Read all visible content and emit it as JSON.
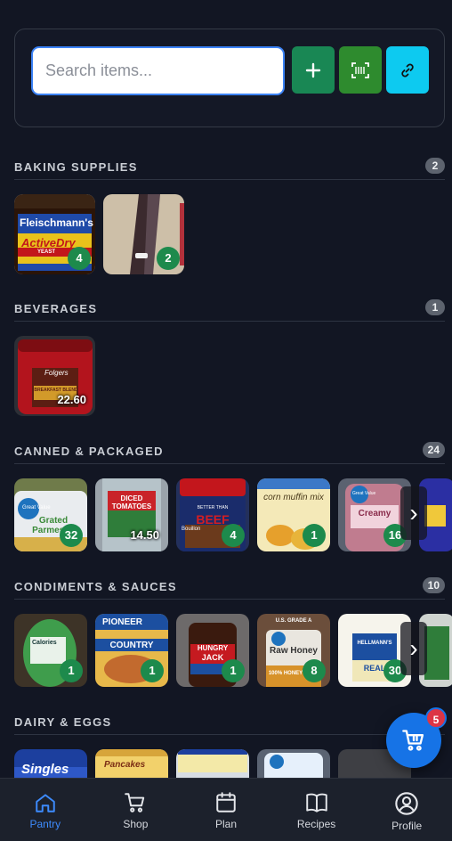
{
  "search": {
    "placeholder": "Search items..."
  },
  "toolbar": {
    "add_icon": "plus-icon",
    "scan_icon": "barcode-scan-icon",
    "link_icon": "link-icon"
  },
  "sections": [
    {
      "title": "BAKING SUPPLIES",
      "count": "2",
      "items": [
        {
          "qty": "4",
          "brand": "Fleischmann's",
          "label": "ActiveDry",
          "sub": "YEAST"
        },
        {
          "qty": "2"
        }
      ]
    },
    {
      "title": "BEVERAGES",
      "count": "1",
      "items": [
        {
          "qty": "22.60",
          "brand": "Folgers",
          "label": "BREAKFAST BLEND"
        }
      ]
    },
    {
      "title": "CANNED & PACKAGED",
      "count": "24",
      "items": [
        {
          "qty": "32",
          "brand": "Great Value",
          "label": "Grated Parmesan"
        },
        {
          "qty": "14.50",
          "label": "DICED TOMATOES"
        },
        {
          "qty": "4",
          "brand": "BETTER THAN",
          "label": "BEEF",
          "sub": "Bouillon"
        },
        {
          "qty": "1",
          "label": "corn muffin mix"
        },
        {
          "qty": "16",
          "brand": "Great Value",
          "label": "Creamy"
        }
      ]
    },
    {
      "title": "CONDIMENTS & SAUCES",
      "count": "10",
      "items": [
        {
          "qty": "1",
          "label": "Calories"
        },
        {
          "qty": "1",
          "brand": "PIONEER",
          "label": "COUNTRY"
        },
        {
          "qty": "1",
          "brand": "HUNGRY",
          "label": "JACK"
        },
        {
          "qty": "8",
          "brand": "U.S. GRADE A",
          "label": "Raw Honey",
          "sub": "100% HONEY"
        },
        {
          "qty": "30",
          "brand": "HELLMANN'S",
          "label": "REAL"
        }
      ]
    },
    {
      "title": "DAIRY & EGGS",
      "count": "",
      "items": [
        {
          "label": "Singles"
        },
        {
          "label": "Pancakes"
        },
        {},
        {},
        {}
      ]
    }
  ],
  "cart": {
    "badge": "5",
    "icon": "cart-icon"
  },
  "nav": [
    {
      "label": "Pantry",
      "icon": "home-icon",
      "active": true
    },
    {
      "label": "Shop",
      "icon": "cart-icon"
    },
    {
      "label": "Plan",
      "icon": "calendar-icon"
    },
    {
      "label": "Recipes",
      "icon": "book-icon"
    },
    {
      "label": "Profile",
      "icon": "user-circle-icon"
    }
  ],
  "colors": {
    "background": "#121623",
    "accent": "#3d8bfd",
    "badge_green": "#1d8a4c",
    "add_button": "#198754",
    "scan_button": "#2e8b2e",
    "link_button": "#0dcaf0",
    "cart_button": "#1673e6",
    "cart_badge": "#dc3545"
  }
}
